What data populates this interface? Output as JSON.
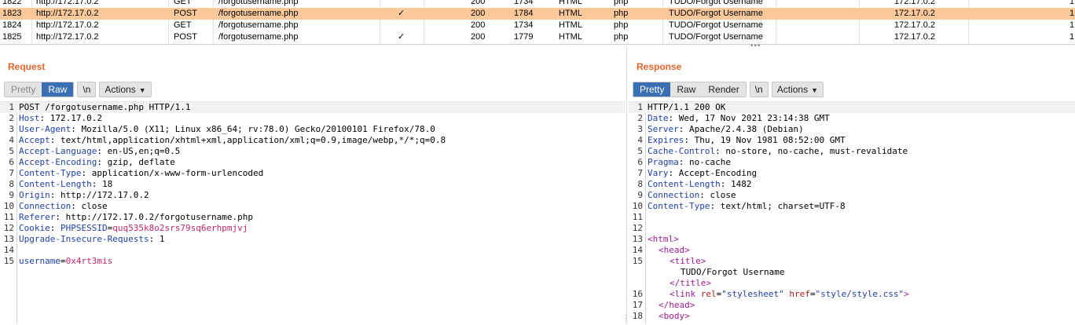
{
  "history": {
    "rows": [
      {
        "num": "1822",
        "host": "http://172.17.0.2",
        "method": "GET",
        "url": "/forgotusername.php",
        "params": "",
        "status": "200",
        "length": "1734",
        "mime": "HTML",
        "ext": "php",
        "title": "TUDO/Forgot Username",
        "ip": "172.17.0.2",
        "last": "1",
        "selected": false
      },
      {
        "num": "1823",
        "host": "http://172.17.0.2",
        "method": "POST",
        "url": "/forgotusername.php",
        "params": "✓",
        "status": "200",
        "length": "1784",
        "mime": "HTML",
        "ext": "php",
        "title": "TUDO/Forgot Username",
        "ip": "172.17.0.2",
        "last": "1",
        "selected": true
      },
      {
        "num": "1824",
        "host": "http://172.17.0.2",
        "method": "GET",
        "url": "/forgotusername.php",
        "params": "",
        "status": "200",
        "length": "1734",
        "mime": "HTML",
        "ext": "php",
        "title": "TUDO/Forgot Username",
        "ip": "172.17.0.2",
        "last": "1",
        "selected": false
      },
      {
        "num": "1825",
        "host": "http://172.17.0.2",
        "method": "POST",
        "url": "/forgotusername.php",
        "params": "✓",
        "status": "200",
        "length": "1779",
        "mime": "HTML",
        "ext": "php",
        "title": "TUDO/Forgot Username",
        "ip": "172.17.0.2",
        "last": "1",
        "selected": false
      }
    ]
  },
  "request": {
    "title": "Request",
    "tabs": {
      "pretty": "Pretty",
      "raw": "Raw"
    },
    "newline": "\\n",
    "actions": "Actions",
    "lines": [
      {
        "n": "1",
        "k": "POST /forgotusername.php HTTP/1.1",
        "v": ""
      },
      {
        "n": "2",
        "k": "Host",
        "v": "172.17.0.2"
      },
      {
        "n": "3",
        "k": "User-Agent",
        "v": "Mozilla/5.0 (X11; Linux x86_64; rv:78.0) Gecko/20100101 Firefox/78.0"
      },
      {
        "n": "4",
        "k": "Accept",
        "v": "text/html,application/xhtml+xml,application/xml;q=0.9,image/webp,*/*;q=0.8"
      },
      {
        "n": "5",
        "k": "Accept-Language",
        "v": "en-US,en;q=0.5"
      },
      {
        "n": "6",
        "k": "Accept-Encoding",
        "v": "gzip, deflate"
      },
      {
        "n": "7",
        "k": "Content-Type",
        "v": "application/x-www-form-urlencoded"
      },
      {
        "n": "8",
        "k": "Content-Length",
        "v": "18"
      },
      {
        "n": "9",
        "k": "Origin",
        "v": "http://172.17.0.2"
      },
      {
        "n": "10",
        "k": "Connection",
        "v": "close"
      },
      {
        "n": "11",
        "k": "Referer",
        "v": "http://172.17.0.2/forgotusername.php"
      },
      {
        "n": "12",
        "k": "Cookie",
        "v": ""
      },
      {
        "n": "13",
        "k": "Upgrade-Insecure-Requests",
        "v": "1"
      },
      {
        "n": "14",
        "k": "",
        "v": ""
      },
      {
        "n": "15",
        "k": "",
        "v": ""
      }
    ],
    "cookie_name": "PHPSESSID",
    "cookie_value": "quq535k8o2srs79sq6erhpmjvj",
    "body_name": "username",
    "body_value": "0x4rt3mis"
  },
  "response": {
    "title": "Response",
    "tabs": {
      "pretty": "Pretty",
      "raw": "Raw",
      "render": "Render"
    },
    "newline": "\\n",
    "actions": "Actions",
    "lines": [
      {
        "n": "1",
        "k": "HTTP/1.1 200 OK",
        "v": ""
      },
      {
        "n": "2",
        "k": "Date",
        "v": "Wed, 17 Nov 2021 23:14:38 GMT"
      },
      {
        "n": "3",
        "k": "Server",
        "v": "Apache/2.4.38 (Debian)"
      },
      {
        "n": "4",
        "k": "Expires",
        "v": "Thu, 19 Nov 1981 08:52:00 GMT"
      },
      {
        "n": "5",
        "k": "Cache-Control",
        "v": "no-store, no-cache, must-revalidate"
      },
      {
        "n": "6",
        "k": "Pragma",
        "v": "no-cache"
      },
      {
        "n": "7",
        "k": "Vary",
        "v": "Accept-Encoding"
      },
      {
        "n": "8",
        "k": "Content-Length",
        "v": "1482"
      },
      {
        "n": "9",
        "k": "Connection",
        "v": "close"
      },
      {
        "n": "10",
        "k": "Content-Type",
        "v": "text/html; charset=UTF-8"
      },
      {
        "n": "11",
        "k": "",
        "v": ""
      },
      {
        "n": "12",
        "k": "",
        "v": ""
      }
    ],
    "html": {
      "n13": "13",
      "n14": "14",
      "n15": "15",
      "n16": "16",
      "n17": "17",
      "n18": "18",
      "html_tag": "<html>",
      "head_open": "<head>",
      "title_open": "<title>",
      "title_text": "TUDO/Forgot Username",
      "title_close": "</title>",
      "link_open": "<link",
      "rel_attr": "rel",
      "rel_val": "\"stylesheet\"",
      "href_attr": "href",
      "href_val": "\"style/style.css\"",
      "link_close": ">",
      "head_close": "</head>",
      "body_open": "<body>"
    }
  }
}
